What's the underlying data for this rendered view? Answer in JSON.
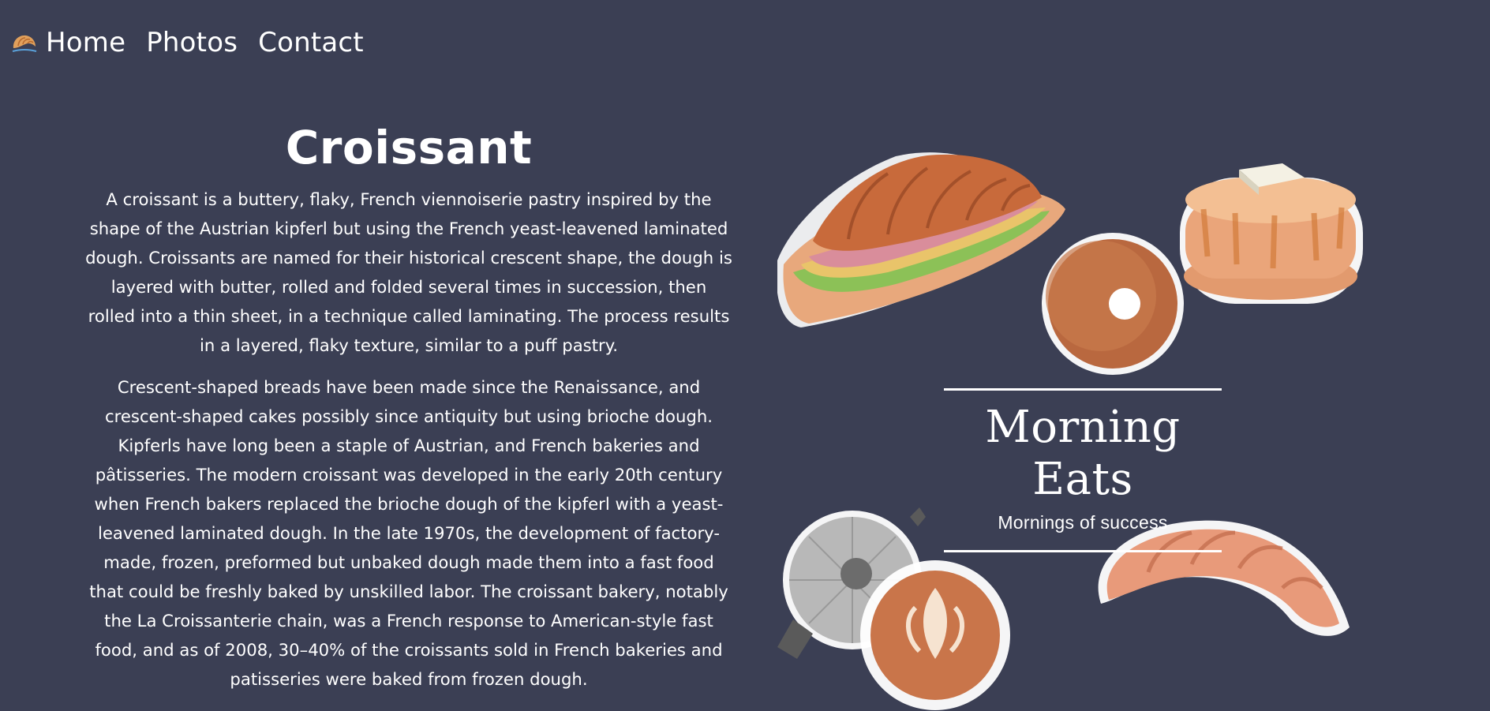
{
  "nav": {
    "logo_icon": "croissant-icon",
    "links": [
      {
        "label": "Home"
      },
      {
        "label": "Photos"
      },
      {
        "label": "Contact"
      }
    ]
  },
  "article": {
    "title": "Croissant",
    "paragraphs": [
      "A croissant is a buttery, flaky, French viennoiserie pastry inspired by the shape of the Austrian kipferl but using the French yeast-leavened laminated dough. Croissants are named for their historical crescent shape, the dough is layered with butter, rolled and folded several times in succession, then rolled into a thin sheet, in a technique called laminating. The process results in a layered, flaky texture, similar to a puff pastry.",
      "Crescent-shaped breads have been made since the Renaissance, and crescent-shaped cakes possibly since antiquity but using brioche dough. Kipferls have long been a staple of Austrian, and French bakeries and pâtisseries. The modern croissant was developed in the early 20th century when French bakers replaced the brioche dough of the kipferl with a yeast-leavened laminated dough. In the late 1970s, the development of factory-made, frozen, preformed but unbaked dough made them into a fast food that could be freshly baked by unskilled labor. The croissant bakery, notably the La Croissanterie chain, was a French response to American-style fast food, and as of 2008, 30–40% of the croissants sold in French bakeries and patisseries were baked from frozen dough."
    ]
  },
  "poster": {
    "brand_title": "Morning Eats",
    "brand_tagline": "Mornings of success",
    "illustrations": [
      "croissant-sandwich-icon",
      "donut-icon",
      "pancakes-icon",
      "moka-pot-icon",
      "latte-icon",
      "croissant-icon"
    ]
  },
  "colors": {
    "background": "#3b3f54",
    "text": "#ffffff",
    "pastry": "#d9895e"
  }
}
